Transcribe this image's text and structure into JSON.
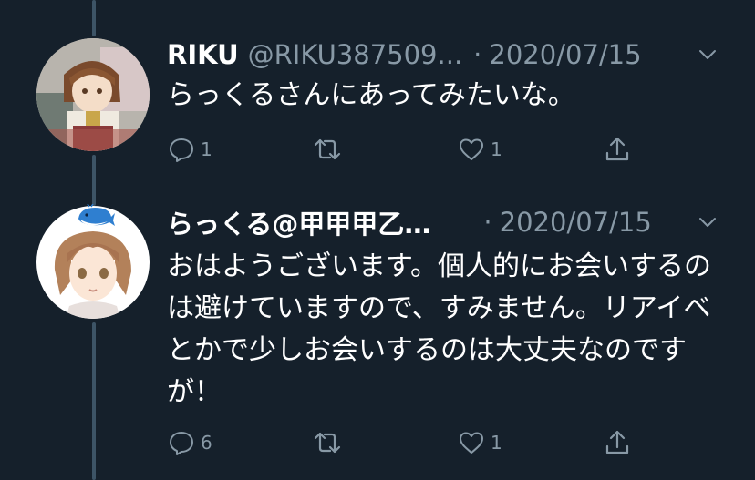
{
  "tweets": [
    {
      "name": "RIKU",
      "handle": "@RIKU387509...",
      "sep": "·",
      "date": "2020/07/15",
      "text": "らっくるさんにあってみたいな。",
      "reply_count": "1",
      "retweet_count": "",
      "like_count": "1",
      "avatar_icon": "anime-character-avatar"
    },
    {
      "name": "らっくる@甲甲甲乙…",
      "handle": "",
      "sep": "·",
      "date": "2020/07/15",
      "text": "おはようございます。個人的にお会いするのは避けていますので、すみません。リアイベとかで少しお会いするのは大丈夫なのですが！",
      "reply_count": "6",
      "retweet_count": "",
      "like_count": "1",
      "avatar_icon": "anime-girl-with-whale-avatar"
    }
  ],
  "colors": {
    "background": "#15202b",
    "secondary_text": "#8899a6",
    "thread_line": "#3d5466",
    "text": "#ffffff"
  }
}
